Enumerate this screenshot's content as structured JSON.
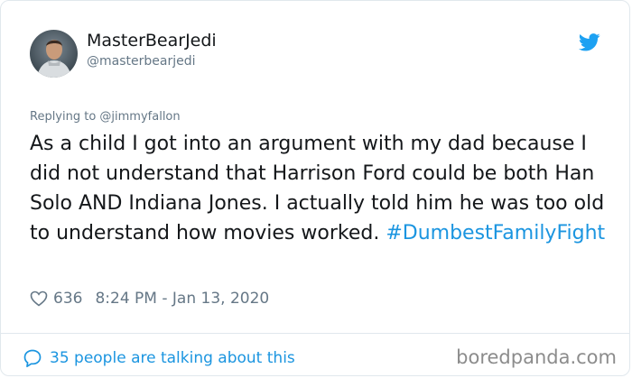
{
  "author": {
    "name": "MasterBearJedi",
    "handle": "@masterbearjedi"
  },
  "reply": {
    "text": "Replying to @jimmyfallon"
  },
  "tweet": {
    "text": "As a child I got into an argument with my dad because I did not understand that Harrison Ford could be both Han Solo AND Indiana Jones. I actually told him he was too old to understand how movies worked. ",
    "hashtag": "#DumbestFamilyFight"
  },
  "meta": {
    "likes": "636",
    "timestamp": "8:24 PM - Jan 13, 2020"
  },
  "footer": {
    "talking": "35 people are talking about this",
    "watermark": "boredpanda.com"
  },
  "colors": {
    "link": "#1b95e0",
    "muted": "#657786",
    "text": "#14171a",
    "border": "#e1e8ed"
  },
  "icons": {
    "brand": "twitter-bird-icon",
    "like": "heart-outline-icon",
    "replies": "speech-bubble-icon"
  }
}
